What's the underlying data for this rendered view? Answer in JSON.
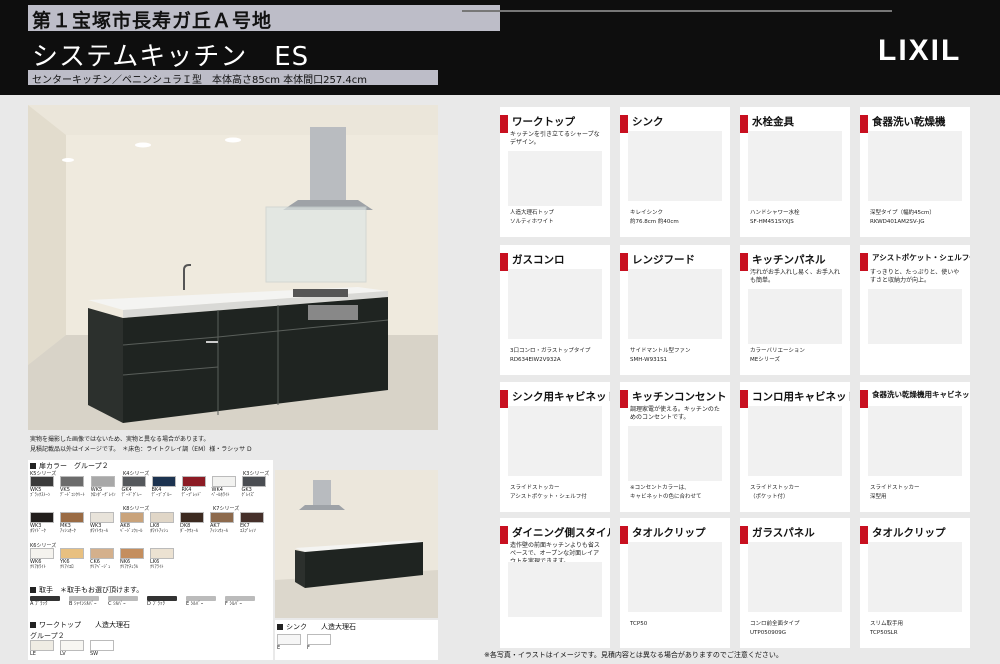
{
  "header": {
    "title": "第１宝塚市長寿ガ丘Ａ号地",
    "series": "システムキッチン　ES",
    "subtitle": "センターキッチン／ペニンシュラＩ型　本体高さ85cm 本体間口257.4cm",
    "logo": "LIXIL"
  },
  "photo_notes": {
    "line1": "実物を撮影した画像ではないため、実物と異なる場合があります。",
    "line2": "見積記載品以外はイメージです。　＊床色：ライトクレイ調（EM）様・ラシッサ D"
  },
  "door_color": {
    "heading": "扉カラー　グループ２",
    "rows": [
      {
        "series_left": "K5シリーズ",
        "series_mid": "K4シリーズ",
        "series_right": "K3シリーズ",
        "swatches": [
          {
            "code": "WK5",
            "name": "ﾌﾞﾗｯｸｽﾄｰﾝ",
            "color": "#3a3a3a"
          },
          {
            "code": "VK5",
            "name": "ﾃﾞｰﾄﾞｺﾝｸﾘｰﾄ",
            "color": "#6b6b6b"
          },
          {
            "code": "WK5",
            "name": "ｸﾛﾝﾀﾞｰｸﾞﾚｲﾝ",
            "color": "#a8a8a8"
          },
          {
            "code": "GK4",
            "name": "ﾃﾞｰﾄﾞｸﾞﾚｰ",
            "color": "#55585c"
          },
          {
            "code": "BK4",
            "name": "ﾃﾞｰﾌﾞﾌﾞﾙｰ",
            "color": "#1c3350"
          },
          {
            "code": "RK4",
            "name": "ﾃﾞｰﾌﾟﾚｯﾄﾞ",
            "color": "#8c1b24"
          },
          {
            "code": "WK4",
            "name": "ﾍﾟｰﾙﾎﾜｲﾄ",
            "color": "#f2f2f0"
          },
          {
            "code": "GK3",
            "name": "ｸﾞﾚｲｽﾞ",
            "color": "#4a4d52"
          }
        ]
      },
      {
        "series_left": "",
        "series_mid": "K8シリーズ",
        "series_right": "K7シリーズ",
        "swatches": [
          {
            "code": "WK3",
            "name": "ﾎﾜｲﾄﾞｰｸ",
            "color": "#221e1c"
          },
          {
            "code": "MK3",
            "name": "ｱｯｼｭｵｰｸ",
            "color": "#9a6b44"
          },
          {
            "code": "WK3",
            "name": "ﾎﾜｲﾄｳｫｰﾙ",
            "color": "#e8e3da"
          },
          {
            "code": "AK8",
            "name": "ﾍﾞｰｼﾞｭｳｫｰﾙ",
            "color": "#c9a37b"
          },
          {
            "code": "LK8",
            "name": "ﾎﾜｲﾄｱｯｼｭ",
            "color": "#e0d6c7"
          },
          {
            "code": "DK8",
            "name": "ﾀﾞｰｸｳｫｰﾙ",
            "color": "#3c2a20"
          },
          {
            "code": "AK7",
            "name": "ｱｯｼｭｳｫｰﾙ",
            "color": "#8d6a4d"
          },
          {
            "code": "EK7",
            "name": "ｴｽﾌﾟﾚｯｿ",
            "color": "#45302a"
          }
        ]
      },
      {
        "series_left": "K6シリーズ",
        "series_mid": "",
        "series_right": "",
        "swatches": [
          {
            "code": "WK6",
            "name": "ｸﾘｱﾎﾜｲﾄ",
            "color": "#f5f3ee"
          },
          {
            "code": "YK6",
            "name": "ｸﾘｱｲｴﾛ",
            "color": "#e8c080"
          },
          {
            "code": "CK6",
            "name": "ｸﾘｱﾍﾞｰｼﾞｭ",
            "color": "#d4b08c"
          },
          {
            "code": "NK6",
            "name": "ｸﾘｱﾅﾁｭﾗﾙ",
            "color": "#c48e5e"
          },
          {
            "code": "LK6",
            "name": "ｸﾘｱﾗｲﾄ",
            "color": "#ece2d2"
          }
        ]
      }
    ]
  },
  "handle": {
    "heading": "取手　＊取手もお選び頂けます。",
    "options": [
      "A ﾌﾞﾗｯｸ",
      "B ｼｬｲﾝｼﾙﾊﾞｰ",
      "C ｼﾙﾊﾞｰ",
      "D ﾌﾞﾗｯｸ",
      "E ｼﾙﾊﾞｰ",
      "F ｼﾙﾊﾞｰ"
    ]
  },
  "worktop": {
    "heading": "ワークトップ　　人造大理石",
    "group": "グループ２",
    "options": [
      {
        "code": "LE",
        "color": "#efece4"
      },
      {
        "code": "LV",
        "color": "#f7f6f2"
      },
      {
        "code": "SW",
        "color": "#ffffff"
      }
    ]
  },
  "sink": {
    "heading": "シンク　　人造大理石",
    "options": [
      {
        "code": "E",
        "color": "#f6f6f6"
      },
      {
        "code": "F",
        "color": "#ffffff"
      }
    ]
  },
  "cards": [
    {
      "title": "ワークトップ",
      "desc": "キッチンを引き立てるシャープなデザイン。",
      "caption1": "人造大理石トップ",
      "caption2": "ソルティホワイト",
      "tab": "red"
    },
    {
      "title": "シンク",
      "desc": "",
      "caption1": "キレイシンク",
      "caption2": "約76.8cm 約40cm",
      "tab": "red"
    },
    {
      "title": "水栓金具",
      "desc": "",
      "caption1": "ハンドシャワー水栓",
      "caption2": "SF-HM451SYXJS",
      "tab": "red"
    },
    {
      "title": "食器洗い乾燥機",
      "desc": "",
      "caption1": "深型タイプ（幅約45cm）",
      "caption2": "RKWD401AM2SV-JG",
      "tab": "red"
    },
    {
      "title": "ガスコンロ",
      "desc": "",
      "caption1": "3口コンロ・ガラストップタイプ",
      "caption2": "RD634EIW2V932A",
      "tab": "red"
    },
    {
      "title": "レンジフード",
      "desc": "",
      "caption1": "サイドマントル型ファン",
      "caption2": "SMH-W931S1",
      "tab": "red"
    },
    {
      "title": "キッチンパネル",
      "desc": "汚れがお手入れし易く、お手入れも簡単。",
      "caption1": "カラーバリエーション",
      "caption2": "MEシリーズ",
      "tab": "red"
    },
    {
      "title": "アシストポケット・シェルフ付",
      "desc": "すっきりと、たっぷりと、使いやすさと収納力が向上。",
      "caption1": "",
      "caption2": "",
      "tab": "red"
    },
    {
      "title": "シンク用キャビネット",
      "desc": "",
      "caption1": "スライドストッカー",
      "caption2": "アシストポケット・シェルフ付",
      "tab": "red"
    },
    {
      "title": "キッチンコンセント",
      "desc": "調理家電が使える。キッチンのためのコンセントです。",
      "caption1": "※コンセントカラーは、",
      "caption2": "キャビネットの色に合わせて",
      "tab": "red"
    },
    {
      "title": "コンロ用キャビネット",
      "desc": "",
      "caption1": "スライドストッカー",
      "caption2": "（ポケット付）",
      "tab": "red"
    },
    {
      "title": "食器洗い乾燥機用キャビネット",
      "desc": "",
      "caption1": "スライドストッカー",
      "caption2": "深型用",
      "tab": "red"
    },
    {
      "title": "ダイニング側スタイル",
      "desc": "造作壁の前面キッチンよりも省スペースで、オープンな対面レイアウトを実現できます。",
      "caption1": "",
      "caption2": "",
      "tab": "red"
    },
    {
      "title": "タオルクリップ",
      "desc": "",
      "caption1": "TCP50",
      "caption2": "",
      "tab": "red"
    },
    {
      "title": "ガラスパネル",
      "desc": "",
      "caption1": "コンロ前全面タイプ",
      "caption2": "UTP050909G",
      "tab": "red"
    },
    {
      "title": "タオルクリップ",
      "desc": "",
      "caption1": "スリム取手用",
      "caption2": "TCP50SLR",
      "tab": "red"
    }
  ],
  "footer": "※各写真・イラストはイメージです。見積内容とは異なる場合がありますのでご注意ください。"
}
